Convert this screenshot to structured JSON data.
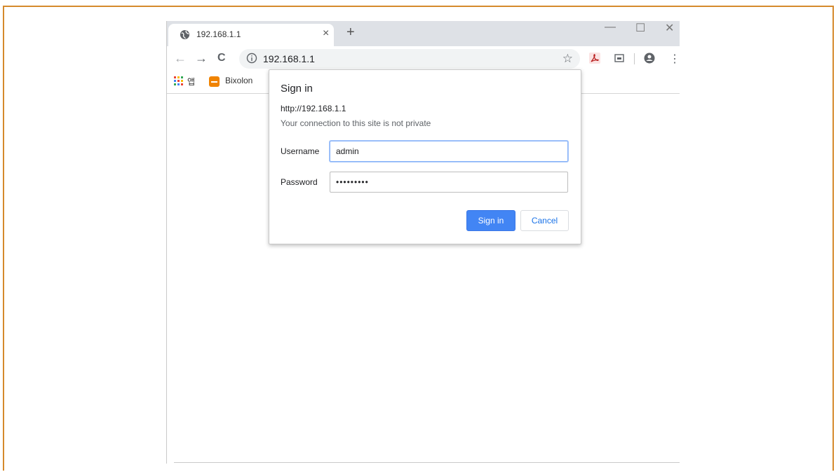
{
  "tab": {
    "title": "192.168.1.1",
    "close_glyph": "×",
    "new_tab_glyph": "+"
  },
  "window_controls": {
    "minimize": "—",
    "maximize": "☐",
    "close": "✕"
  },
  "toolbar": {
    "back": "←",
    "forward": "→",
    "reload": "C",
    "url": "192.168.1.1",
    "star": "☆",
    "menu": "⋮"
  },
  "bookmarks": {
    "apps_label": "앱",
    "items": [
      {
        "label": "Bixolon",
        "icon": "bixolon-icon",
        "color": "#f08300"
      }
    ]
  },
  "dialog": {
    "title": "Sign in",
    "origin": "http://192.168.1.1",
    "warning": "Your connection to this site is not private",
    "username_label": "Username",
    "username_value": "admin",
    "password_label": "Password",
    "password_value": "•••••••••",
    "sign_in_label": "Sign in",
    "cancel_label": "Cancel"
  },
  "colors": {
    "accent": "#4285f4",
    "frame": "#d58a2c",
    "tabstrip": "#dee1e6",
    "omnibox": "#f1f3f4"
  }
}
